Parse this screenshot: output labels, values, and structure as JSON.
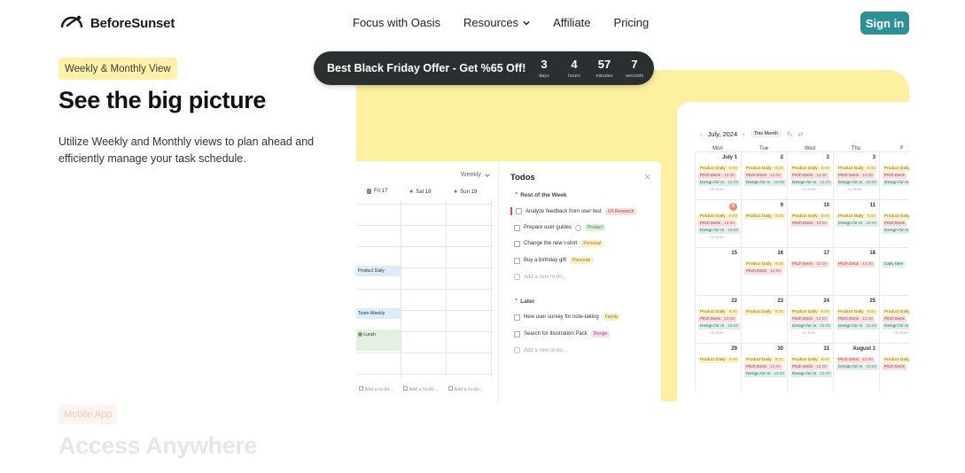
{
  "brand": {
    "name": "BeforeSunset"
  },
  "nav": {
    "links": [
      "Focus with Oasis",
      "Resources",
      "Affiliate",
      "Pricing"
    ],
    "signin": "Sign in"
  },
  "promo": {
    "text": "Best Black Friday Offer - Get %65 Off!",
    "countdown": [
      {
        "value": "3",
        "label": "days"
      },
      {
        "value": "4",
        "label": "hours"
      },
      {
        "value": "57",
        "label": "minutes"
      },
      {
        "value": "7",
        "label": "seconds"
      }
    ]
  },
  "hero": {
    "badge": "Weekly & Monthly View",
    "title": "See the big picture",
    "description": "Utilize Weekly and Monthly views to plan ahead and efficiently manage your task schedule."
  },
  "next_section": {
    "badge": "Mobile App",
    "title": "Access Anywhere"
  },
  "weekly": {
    "selector": "Weekly",
    "days": [
      "Fri 17",
      "Sat 18",
      "Sun 19"
    ],
    "events": [
      "Product Daily",
      "Team-Weekly",
      "Lunch"
    ],
    "add_todo": "Add a to-do..."
  },
  "todos": {
    "title": "Todos",
    "rest_of_week": "Rest of the Week",
    "items": [
      {
        "text": "Analyze feedback from user test",
        "tag": "UX Research"
      },
      {
        "text": "Prepare user guides",
        "tag": "Product"
      },
      {
        "text": "Change the new t-shirt",
        "tag": "Personal"
      },
      {
        "text": "Buy a birthday gift",
        "tag": "Personal"
      }
    ],
    "add_new": "Add a new to-do...",
    "later": "Later",
    "later_items": [
      {
        "text": "New user survey for note-taking",
        "tag": "Family"
      },
      {
        "text": "Search for Illustration Pack",
        "tag": "Design"
      }
    ],
    "add_new2": "Add a new to-do..."
  },
  "monthly": {
    "month": "July, 2024",
    "this_month": "This Month",
    "dow": [
      "Mon",
      "Tue",
      "Wed",
      "Thu",
      "F"
    ],
    "events": {
      "product": "Product Daily",
      "pitch": "Pitch Deck",
      "design": "Design for m",
      "t9": "9:00",
      "t12": "12:00",
      "t15": "15:00",
      "daily": "Daily Mee",
      "more": "+1 more",
      "more3": "+3 more"
    },
    "weeks": [
      [
        "July 1",
        "2",
        "2",
        "3",
        ""
      ],
      [
        "8",
        "9",
        "10",
        "11",
        ""
      ],
      [
        "15",
        "16",
        "17",
        "18",
        ""
      ],
      [
        "22",
        "23",
        "24",
        "25",
        ""
      ],
      [
        "29",
        "30",
        "31",
        "August 1",
        ""
      ]
    ]
  },
  "colors": {
    "accent": "#2e8f9a",
    "showcase_bg": "#fdf0a0",
    "badge_bg": "#fdf2a8",
    "promo_bg": "#2a2f2f"
  }
}
